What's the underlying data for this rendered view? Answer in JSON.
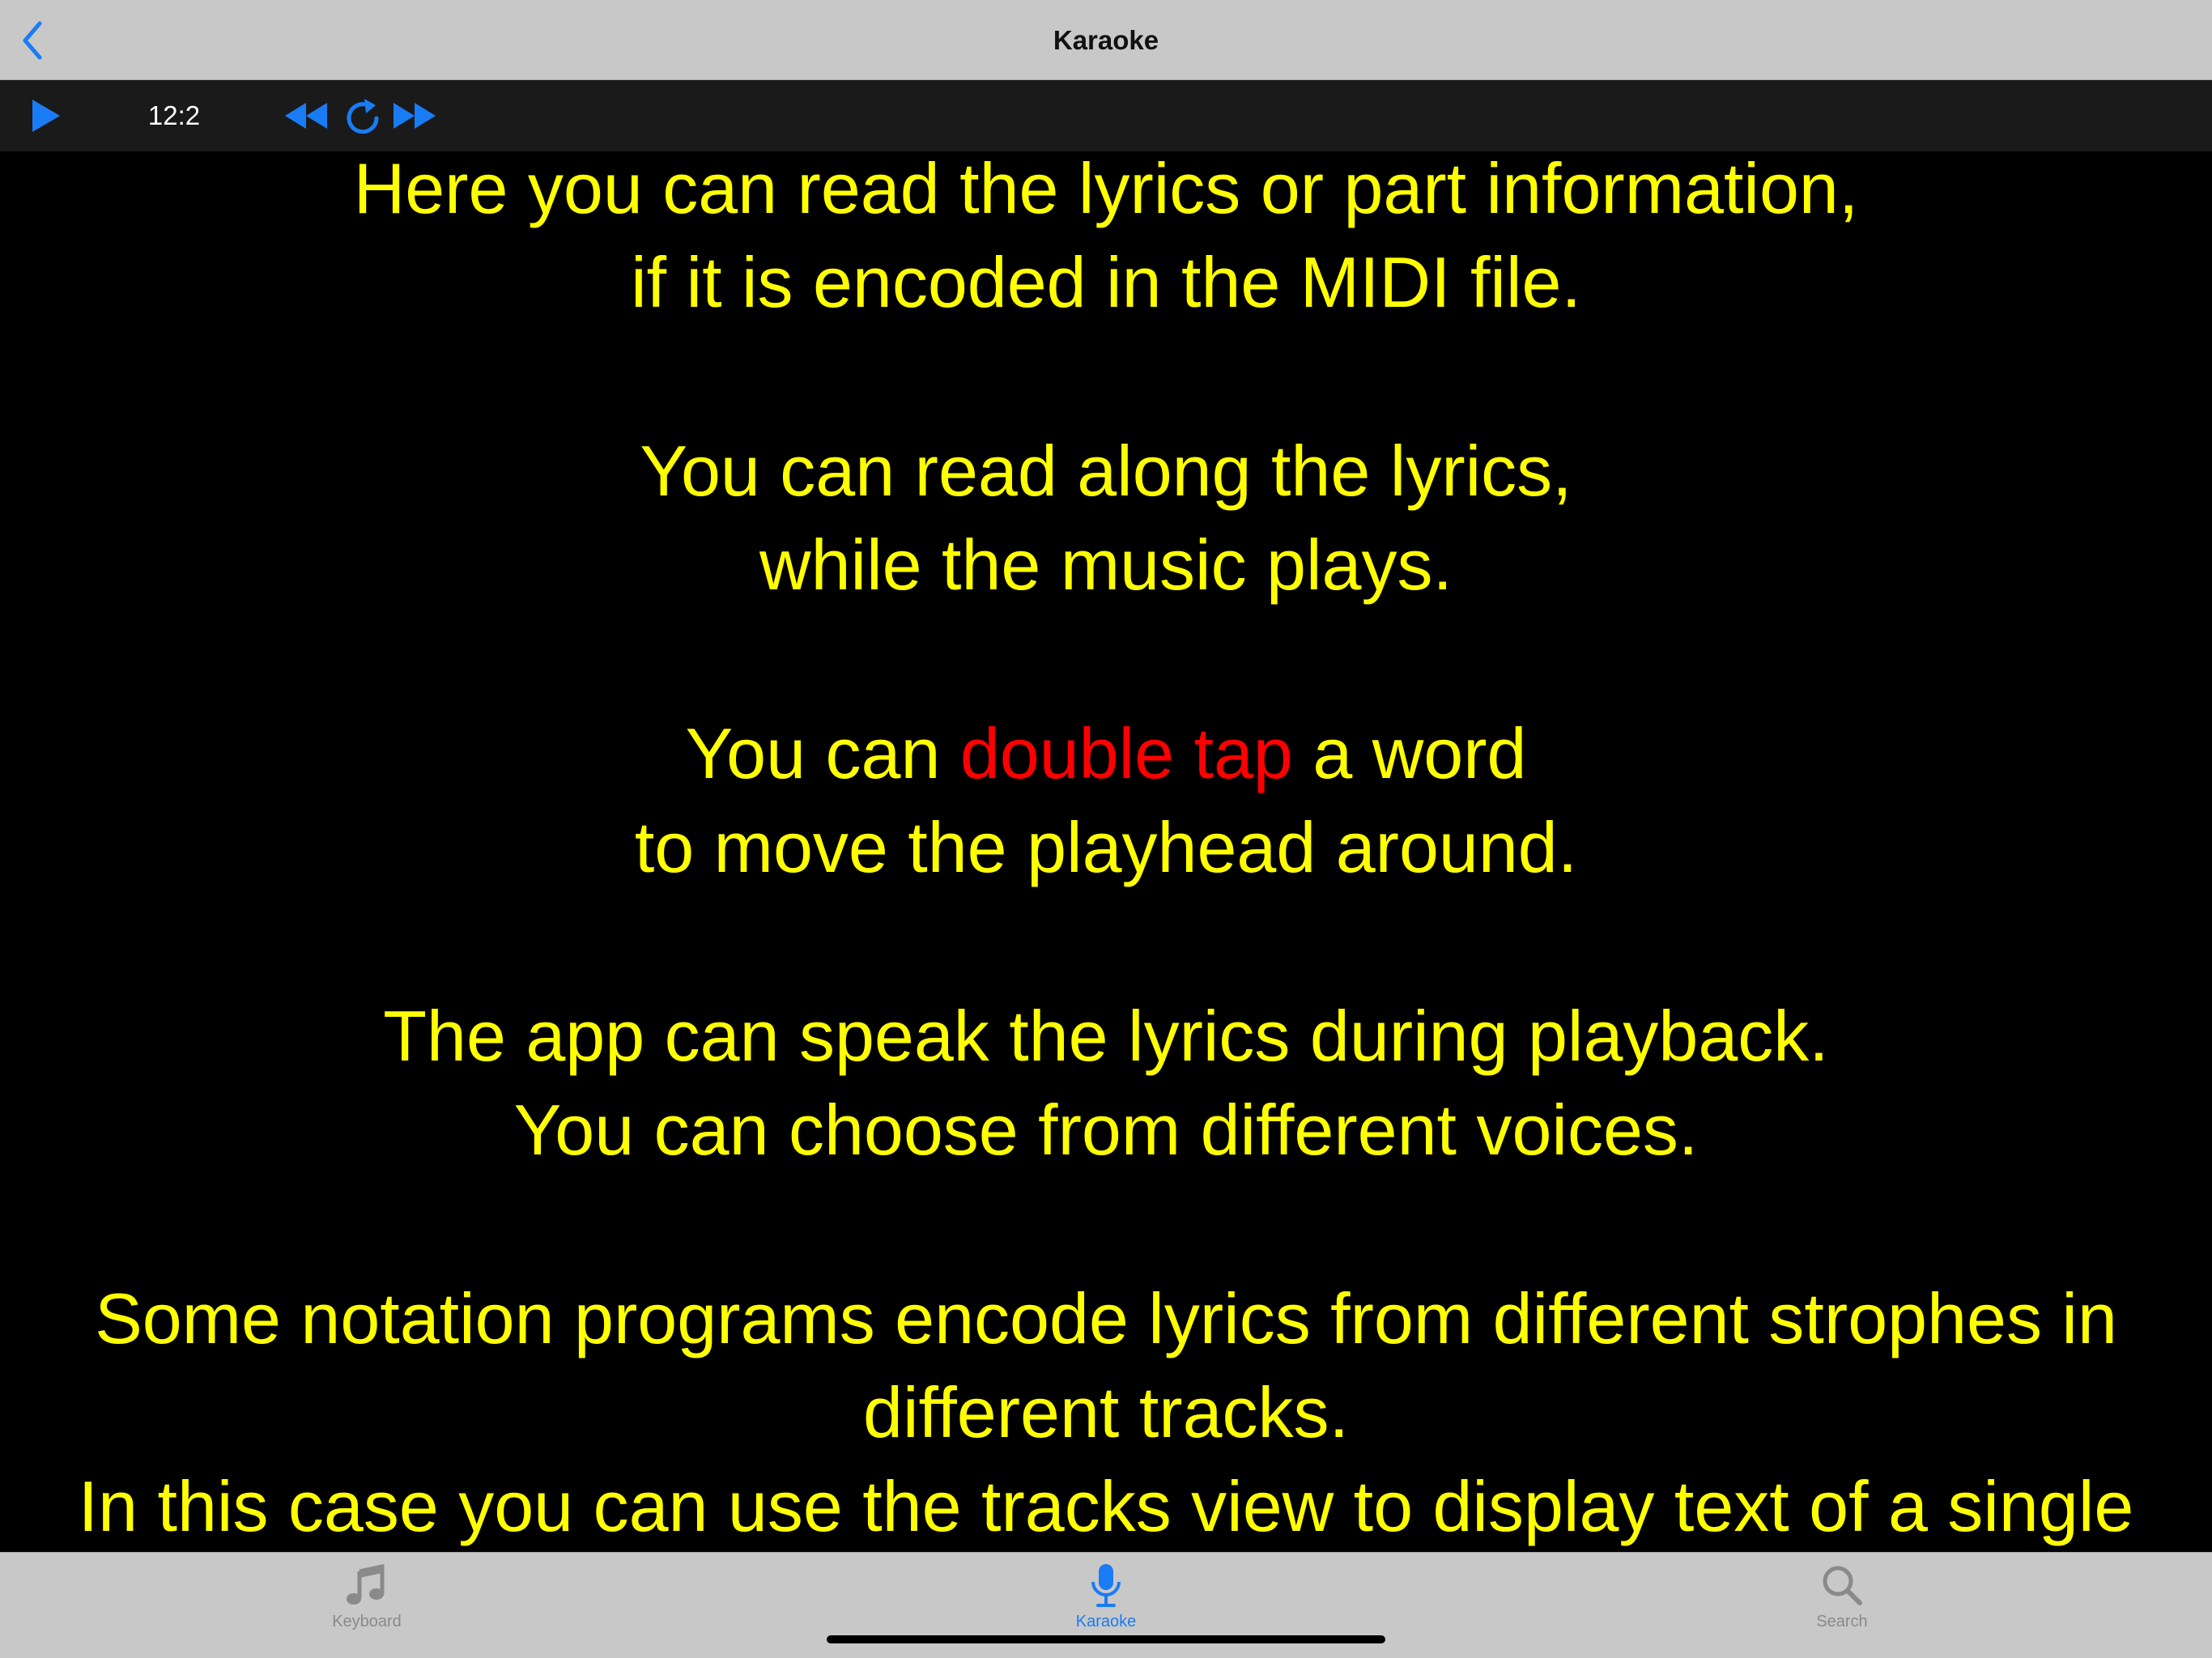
{
  "nav": {
    "title": "Karaoke",
    "back_icon": "chevron-left-icon"
  },
  "toolbar": {
    "play_icon": "play-icon",
    "time": "12:2",
    "rewind_icon": "rewind-icon",
    "repeat_icon": "repeat-icon",
    "fast_forward_icon": "fast-forward-icon"
  },
  "lyrics": {
    "p1": {
      "line1": "Here you can read the lyrics or part information,",
      "line2": "if it is encoded in the MIDI file."
    },
    "p2": {
      "line1": "You can read along the lyrics,",
      "line2": "while the music plays."
    },
    "p3": {
      "line1_pre": "You can ",
      "line1_highlight": "double tap",
      "line1_post": " a word",
      "line2": "to move the playhead around."
    },
    "p4": {
      "line1": "The app can speak the lyrics during playback.",
      "line2": "You can choose from different voices."
    },
    "p5": {
      "line1": "Some notation programs encode lyrics from different strophes in different tracks.",
      "line2": "In this case you can use the tracks view to display text of a single"
    }
  },
  "tabs": [
    {
      "label": "Keyboard",
      "icon": "music-note-icon",
      "active": false
    },
    {
      "label": "Karaoke",
      "icon": "microphone-icon",
      "active": true
    },
    {
      "label": "Search",
      "icon": "search-icon",
      "active": false
    }
  ],
  "colors": {
    "lyrics_text": "#ffff00",
    "highlight": "#ff0000",
    "accent": "#1a7cf5",
    "inactive_tab": "#8a8a8a"
  }
}
